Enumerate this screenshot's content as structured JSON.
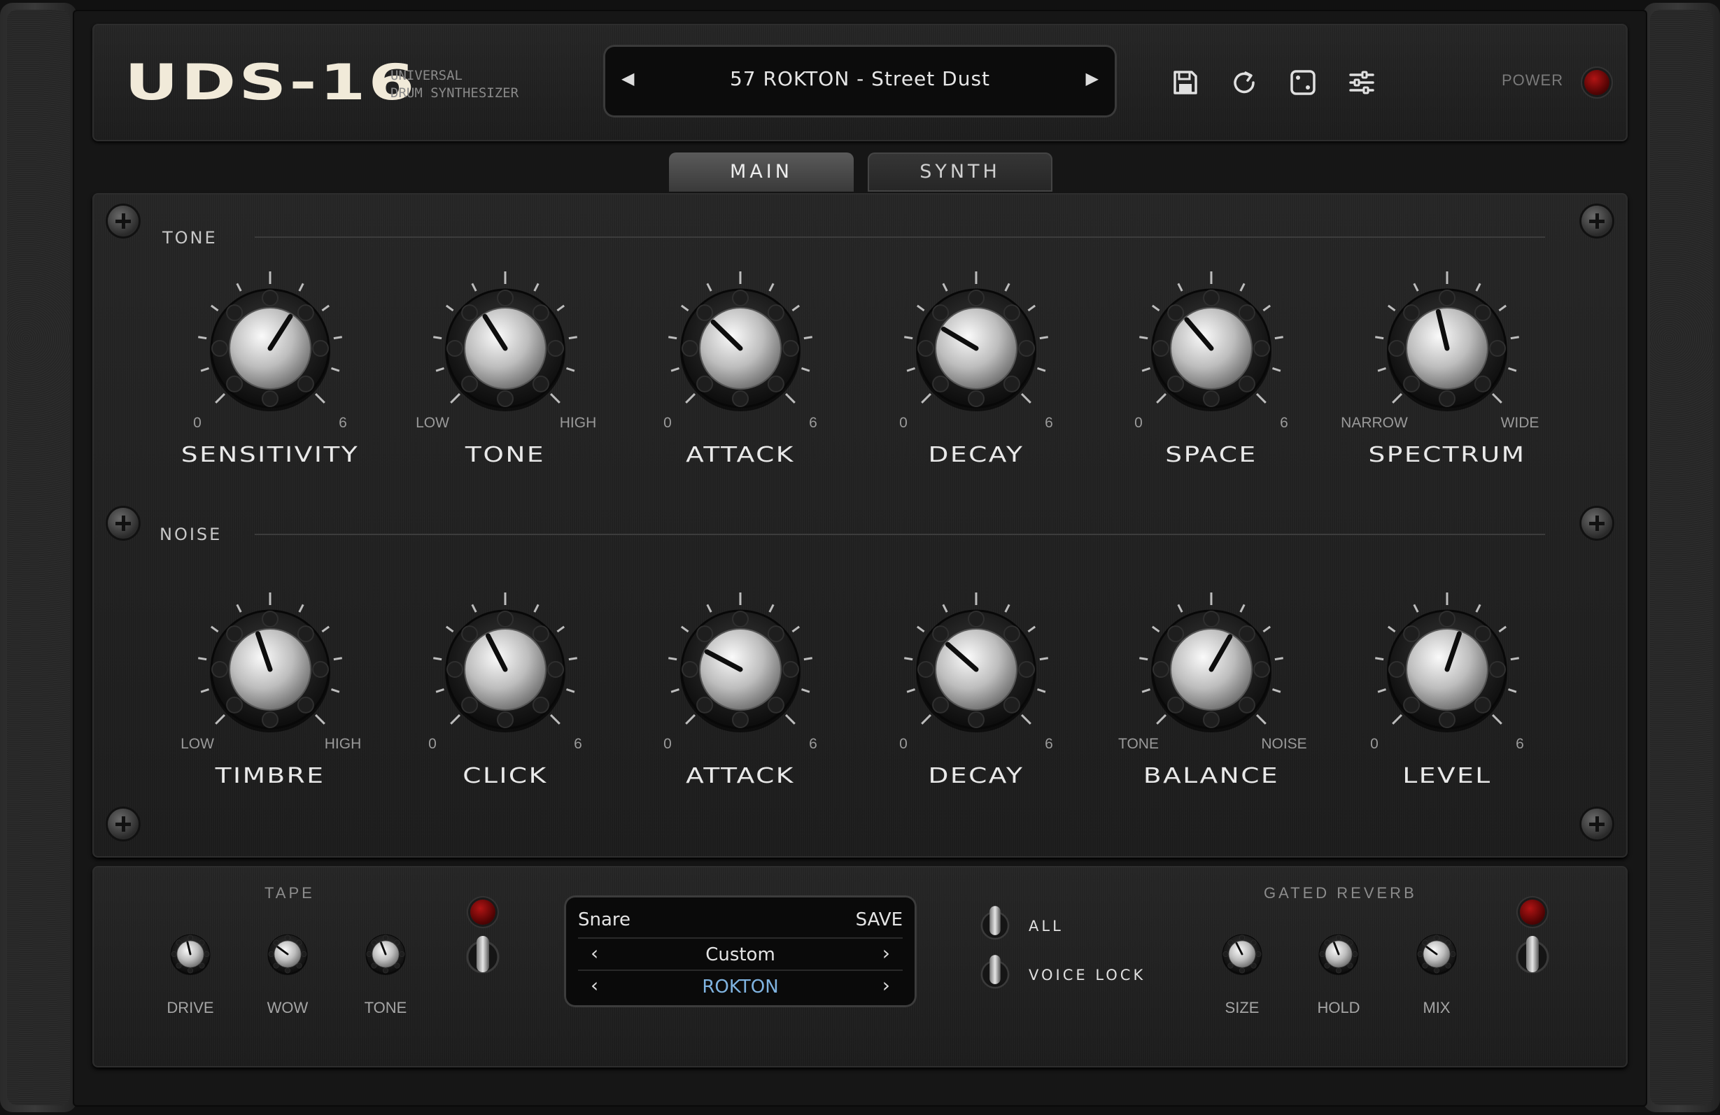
{
  "header": {
    "logo": "UDS-16",
    "subtitle": "UNIVERSAL\nDRUM SYNTHESIZER",
    "preset_name": "57  ROKTON - Street Dust",
    "power_label": "POWER"
  },
  "icons": {
    "save": "floppy-disk-icon",
    "reset": "reset-icon",
    "random": "dice-icon",
    "settings": "sliders-icon"
  },
  "tabs": [
    {
      "label": "MAIN",
      "active": true
    },
    {
      "label": "SYNTH",
      "active": false
    }
  ],
  "tone": {
    "title": "TONE",
    "knobs": [
      {
        "label": "SENSITIVITY",
        "min": "0",
        "max": "6",
        "value": 0.62
      },
      {
        "label": "TONE",
        "min": "LOW",
        "max": "HIGH",
        "value": 0.38
      },
      {
        "label": "ATTACK",
        "min": "0",
        "max": "6",
        "value": 0.33
      },
      {
        "label": "DECAY",
        "min": "0",
        "max": "6",
        "value": 0.28
      },
      {
        "label": "SPACE",
        "min": "0",
        "max": "6",
        "value": 0.35
      },
      {
        "label": "SPECTRUM",
        "min": "NARROW",
        "max": "WIDE",
        "value": 0.45
      }
    ]
  },
  "noise": {
    "title": "NOISE",
    "knobs": [
      {
        "label": "TIMBRE",
        "min": "LOW",
        "max": "HIGH",
        "value": 0.43
      },
      {
        "label": "CLICK",
        "min": "0",
        "max": "6",
        "value": 0.4
      },
      {
        "label": "ATTACK",
        "min": "0",
        "max": "6",
        "value": 0.27
      },
      {
        "label": "DECAY",
        "min": "0",
        "max": "6",
        "value": 0.32
      },
      {
        "label": "BALANCE",
        "min": "TONE",
        "max": "NOISE",
        "value": 0.61
      },
      {
        "label": "LEVEL",
        "min": "0",
        "max": "6",
        "value": 0.57
      }
    ]
  },
  "tape": {
    "title": "TAPE",
    "knobs": [
      {
        "label": "DRIVE",
        "value": 0.45
      },
      {
        "label": "WOW",
        "value": 0.3
      },
      {
        "label": "TONE",
        "value": 0.42
      }
    ]
  },
  "display": {
    "instrument": "Snare",
    "save_label": "SAVE",
    "kit": "Custom",
    "bank": "ROKTON",
    "bank_color": "#7fb3e0"
  },
  "switches": {
    "all": "ALL",
    "voice_lock": "VOICE LOCK"
  },
  "gated_reverb": {
    "title": "GATED REVERB",
    "knobs": [
      {
        "label": "SIZE",
        "value": 0.4
      },
      {
        "label": "HOLD",
        "value": 0.42
      },
      {
        "label": "MIX",
        "value": 0.3
      }
    ]
  },
  "colors": {
    "led": "#a31212",
    "text_light": "#e9e9e9"
  }
}
